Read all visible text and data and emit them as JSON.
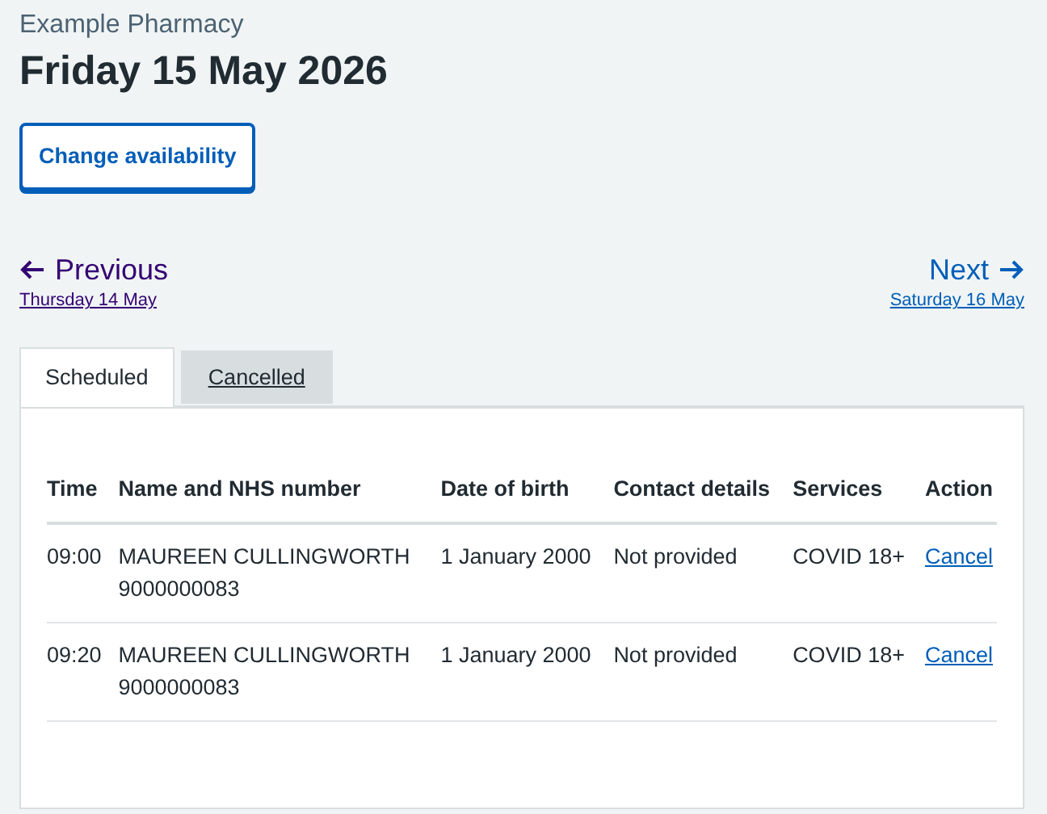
{
  "caption": "Example Pharmacy",
  "heading": "Friday 15 May 2026",
  "change_button": "Change availability",
  "pagination": {
    "previous": {
      "label": "Previous",
      "date": "Thursday 14 May",
      "visited": true
    },
    "next": {
      "label": "Next",
      "date": "Saturday 16 May",
      "visited": false
    }
  },
  "tabs": [
    {
      "label": "Scheduled",
      "selected": true
    },
    {
      "label": "Cancelled",
      "selected": false
    }
  ],
  "table": {
    "columns": [
      "Time",
      "Name and NHS number",
      "Date of birth",
      "Contact details",
      "Services",
      "Action"
    ],
    "rows": [
      {
        "time": "09:00",
        "name": "MAUREEN CULLINGWORTH",
        "nhs_number": "9000000083",
        "date_of_birth": "1 January 2000",
        "contact_details": "Not provided",
        "services": "COVID 18+",
        "action": "Cancel"
      },
      {
        "time": "09:20",
        "name": "MAUREEN CULLINGWORTH",
        "nhs_number": "9000000083",
        "date_of_birth": "1 January 2000",
        "contact_details": "Not provided",
        "services": "COVID 18+",
        "action": "Cancel"
      }
    ]
  }
}
